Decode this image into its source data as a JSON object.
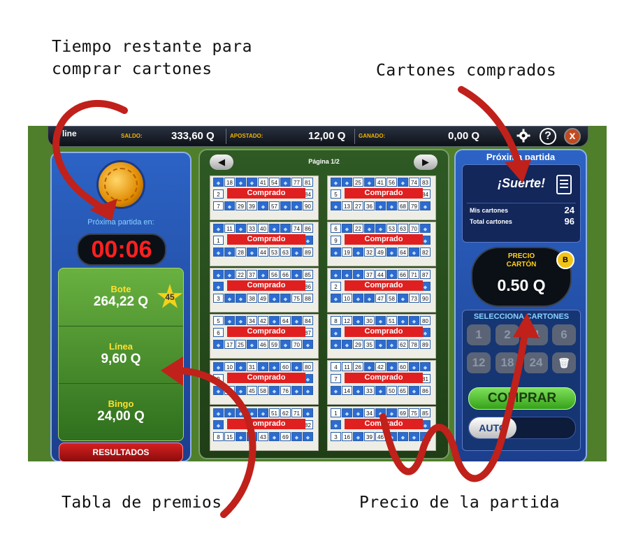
{
  "annotations": {
    "timer_note_line1": "Tiempo restante para",
    "timer_note_line2": "comprar cartones",
    "bought_note": "Cartones comprados",
    "prizes_note": "Tabla de premios",
    "price_note": "Precio de la partida"
  },
  "topbar": {
    "logo": "line",
    "saldo_label": "SALDO:",
    "saldo_value": "333,60 Q",
    "apostado_label": "APOSTADO:",
    "apostado_value": "12,00 Q",
    "ganado_label": "GANADO:",
    "ganado_value": "0,00 Q",
    "settings_icon": "gear-icon",
    "help_icon": "question-icon",
    "close_icon": "close-icon",
    "help_glyph": "?",
    "close_glyph": "x"
  },
  "left": {
    "next_label": "Próxima partida en:",
    "timer": "00:06",
    "prizes": [
      {
        "label": "Bote",
        "value": "264,22 Q"
      },
      {
        "label": "Línea",
        "value": "9,60 Q"
      },
      {
        "label": "Bingo",
        "value": "24,00 Q"
      }
    ],
    "bote_badge": "45",
    "results_label": "RESULTADOS"
  },
  "center": {
    "page_label": "Página 1/2",
    "prev_glyph": "◀",
    "next_glyph": "▶",
    "status": "Comprado",
    "cards": [
      {
        "r1": [
          "D",
          "18",
          "D",
          "D",
          "41",
          "54",
          "D",
          "77",
          "81"
        ],
        "r2": [
          "2",
          "",
          "",
          "",
          "",
          "",
          "",
          "",
          "84"
        ],
        "r3": [
          "7",
          "D",
          "29",
          "39",
          "D",
          "57",
          "D",
          "D",
          "90"
        ]
      },
      {
        "r1": [
          "D",
          "D",
          "25",
          "D",
          "41",
          "56",
          "D",
          "74",
          "83"
        ],
        "r2": [
          "5",
          "",
          "",
          "",
          "",
          "",
          "",
          "",
          "84"
        ],
        "r3": [
          "D",
          "13",
          "27",
          "36",
          "D",
          "D",
          "68",
          "79",
          "D"
        ]
      },
      {
        "r1": [
          "D",
          "11",
          "D",
          "33",
          "40",
          "D",
          "D",
          "74",
          "86"
        ],
        "r2": [
          "1",
          "",
          "",
          "",
          "",
          "",
          "",
          "",
          "D"
        ],
        "r3": [
          "D",
          "D",
          "28",
          "D",
          "44",
          "53",
          "63",
          "D",
          "89"
        ]
      },
      {
        "r1": [
          "6",
          "D",
          "22",
          "D",
          "D",
          "53",
          "63",
          "70",
          "D"
        ],
        "r2": [
          "9",
          "",
          "",
          "",
          "",
          "",
          "",
          "",
          "D"
        ],
        "r3": [
          "D",
          "19",
          "D",
          "32",
          "49",
          "D",
          "64",
          "D",
          "82"
        ]
      },
      {
        "r1": [
          "D",
          "D",
          "22",
          "37",
          "D",
          "56",
          "66",
          "D",
          "85"
        ],
        "r2": [
          "D",
          "",
          "",
          "",
          "",
          "",
          "",
          "",
          "86"
        ],
        "r3": [
          "3",
          "D",
          "D",
          "38",
          "49",
          "D",
          "D",
          "75",
          "88"
        ]
      },
      {
        "r1": [
          "D",
          "D",
          "D",
          "37",
          "44",
          "D",
          "66",
          "71",
          "87"
        ],
        "r2": [
          "2",
          "",
          "",
          "",
          "",
          "",
          "",
          "",
          "D"
        ],
        "r3": [
          "D",
          "10",
          "D",
          "D",
          "47",
          "58",
          "D",
          "73",
          "90"
        ]
      },
      {
        "r1": [
          "5",
          "D",
          "D",
          "34",
          "42",
          "D",
          "64",
          "D",
          "84"
        ],
        "r2": [
          "6",
          "",
          "",
          "",
          "",
          "",
          "",
          "",
          "87"
        ],
        "r3": [
          "D",
          "17",
          "25",
          "D",
          "46",
          "59",
          "D",
          "70",
          "D"
        ]
      },
      {
        "r1": [
          "8",
          "12",
          "D",
          "30",
          "D",
          "51",
          "D",
          "D",
          "80"
        ],
        "r2": [
          "D",
          "",
          "",
          "",
          "",
          "",
          "",
          "",
          "D"
        ],
        "r3": [
          "D",
          "D",
          "29",
          "35",
          "D",
          "D",
          "62",
          "78",
          "89"
        ]
      },
      {
        "r1": [
          "D",
          "10",
          "D",
          "31",
          "D",
          "D",
          "60",
          "D",
          "80"
        ],
        "r2": [
          "9",
          "",
          "",
          "",
          "",
          "",
          "",
          "",
          "D"
        ],
        "r3": [
          "D",
          "26",
          "D",
          "45",
          "58",
          "D",
          "76",
          "D",
          "D"
        ]
      },
      {
        "r1": [
          "4",
          "11",
          "26",
          "D",
          "42",
          "D",
          "60",
          "D",
          "D"
        ],
        "r2": [
          "7",
          "",
          "",
          "",
          "",
          "",
          "",
          "",
          "81"
        ],
        "r3": [
          "D",
          "14",
          "D",
          "33",
          "D",
          "50",
          "65",
          "D",
          "86"
        ]
      },
      {
        "r1": [
          "D",
          "D",
          "D",
          "D",
          "D",
          "51",
          "62",
          "71",
          "D"
        ],
        "r2": [
          "D",
          "",
          "",
          "",
          "",
          "",
          "",
          "",
          "82"
        ],
        "r3": [
          "8",
          "15",
          "D",
          "D",
          "43",
          "D",
          "69",
          "D",
          "D"
        ]
      },
      {
        "r1": [
          "1",
          "D",
          "D",
          "34",
          "D",
          "D",
          "69",
          "75",
          "85"
        ],
        "r2": [
          "D",
          "",
          "",
          "",
          "",
          "",
          "",
          "",
          "D"
        ],
        "r3": [
          "3",
          "16",
          "D",
          "39",
          "46",
          "D",
          "D",
          "D",
          "D"
        ]
      }
    ]
  },
  "right": {
    "title": "Próxima partida",
    "suerte": "¡Suerte!",
    "mis_cartones_label": "Mis cartones",
    "mis_cartones_value": "24",
    "total_cartones_label": "Total cartones",
    "total_cartones_value": "96",
    "price_label_1": "PRECIO",
    "price_label_2": "CARTÓN",
    "price_value": "0.50 Q",
    "coin_label": "B",
    "select_title": "SELECCIONA CARTONES",
    "buttons": [
      "1",
      "2",
      "4",
      "6",
      "12",
      "18",
      "24"
    ],
    "trash_icon": "trash-icon",
    "trash_glyph": "🗑",
    "comprar_label": "COMPRAR",
    "auto_label": "AUTO"
  },
  "colors": {
    "arrow_red": "#c0211a",
    "game_bg": "#4f7f2a",
    "panel_blue": "#2c63c5",
    "timer_red": "#ff2020"
  }
}
